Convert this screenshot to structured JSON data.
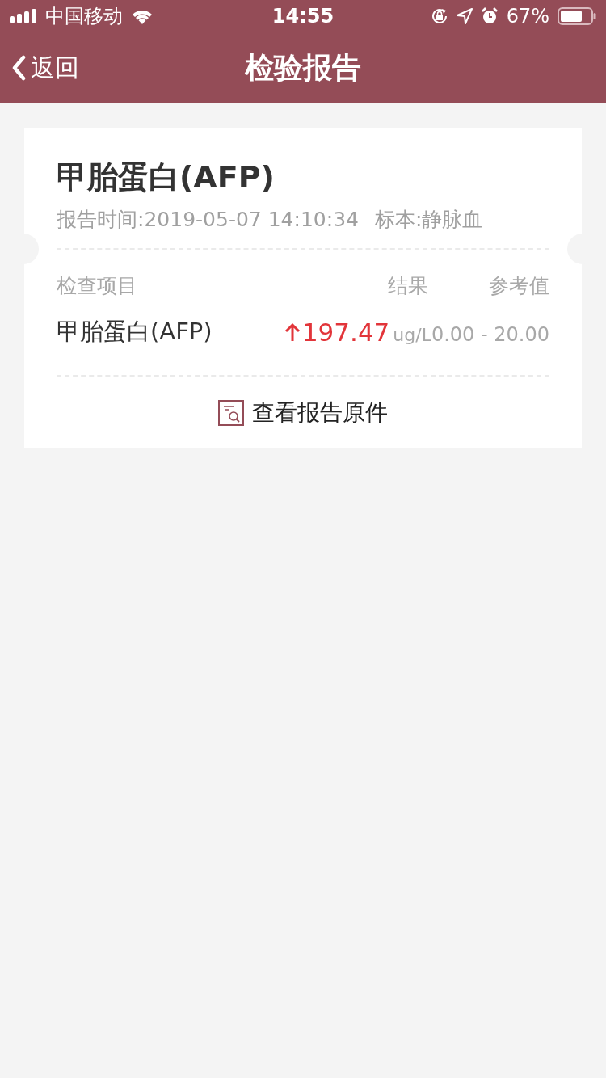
{
  "status_bar": {
    "carrier": "中国移动",
    "time": "14:55",
    "battery": "67%"
  },
  "nav": {
    "back": "返回",
    "title": "检验报告"
  },
  "report": {
    "title": "甲胎蛋白(AFP)",
    "report_time": "报告时间:2019-05-07 14:10:34",
    "specimen": "标本:静脉血",
    "columns": [
      "检查项目",
      "结果",
      "参考值"
    ],
    "rows": [
      {
        "item": "甲胎蛋白(AFP)",
        "high": true,
        "result": "197.47",
        "unit": "ug/L",
        "reference": "0.00 - 20.00"
      }
    ],
    "view_original": "查看报告原件"
  }
}
